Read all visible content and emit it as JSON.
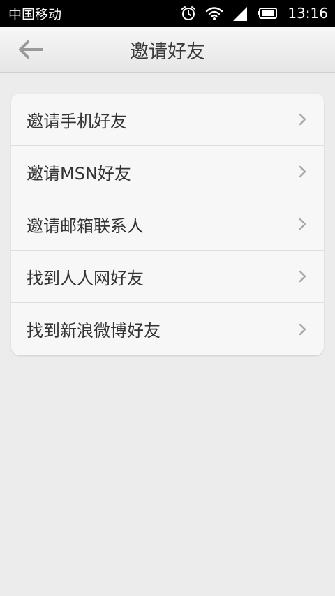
{
  "status_bar": {
    "carrier": "中国移动",
    "time": "13:16",
    "icons": [
      "alarm-icon",
      "wifi-icon",
      "signal-icon",
      "battery-icon"
    ]
  },
  "header": {
    "title": "邀请好友",
    "back_icon": "back-arrow-icon"
  },
  "menu": {
    "items": [
      {
        "label": "邀请手机好友"
      },
      {
        "label": "邀请MSN好友"
      },
      {
        "label": "邀请邮箱联系人"
      },
      {
        "label": "找到人人网好友"
      },
      {
        "label": "找到新浪微博好友"
      }
    ]
  },
  "colors": {
    "background": "#ececec",
    "card": "#f7f7f7",
    "text": "#333333",
    "chevron": "#a9a9a9"
  }
}
